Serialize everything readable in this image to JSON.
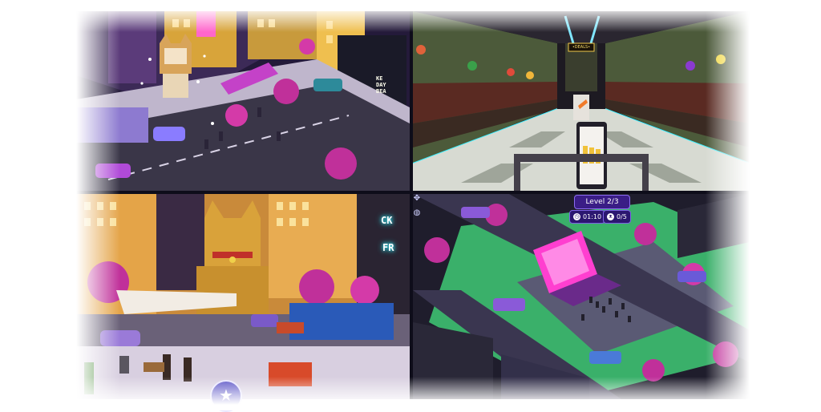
{
  "market_scene": {
    "sign_text": "•DEALS•"
  },
  "stage_scene": {
    "level_label": "Level",
    "level_value": "2/3",
    "timer_value": "01:10",
    "counter_value": "0/5",
    "timer_icon": "clock-icon",
    "counter_icon": "cat-icon"
  },
  "street_scene": {
    "neon_sign_1": "CK",
    "neon_sign_2": "FR",
    "action_icon": "star-icon"
  },
  "city_scene": {
    "vertical_sign": "KE DAY BEA"
  },
  "side_icons": [
    "move-icon",
    "globe-icon"
  ],
  "colors": {
    "accent_purple": "#3a1d86",
    "neon_pink": "#ff3fd0",
    "neon_cyan": "#2ff0ff",
    "tree_magenta": "#c0309a"
  }
}
